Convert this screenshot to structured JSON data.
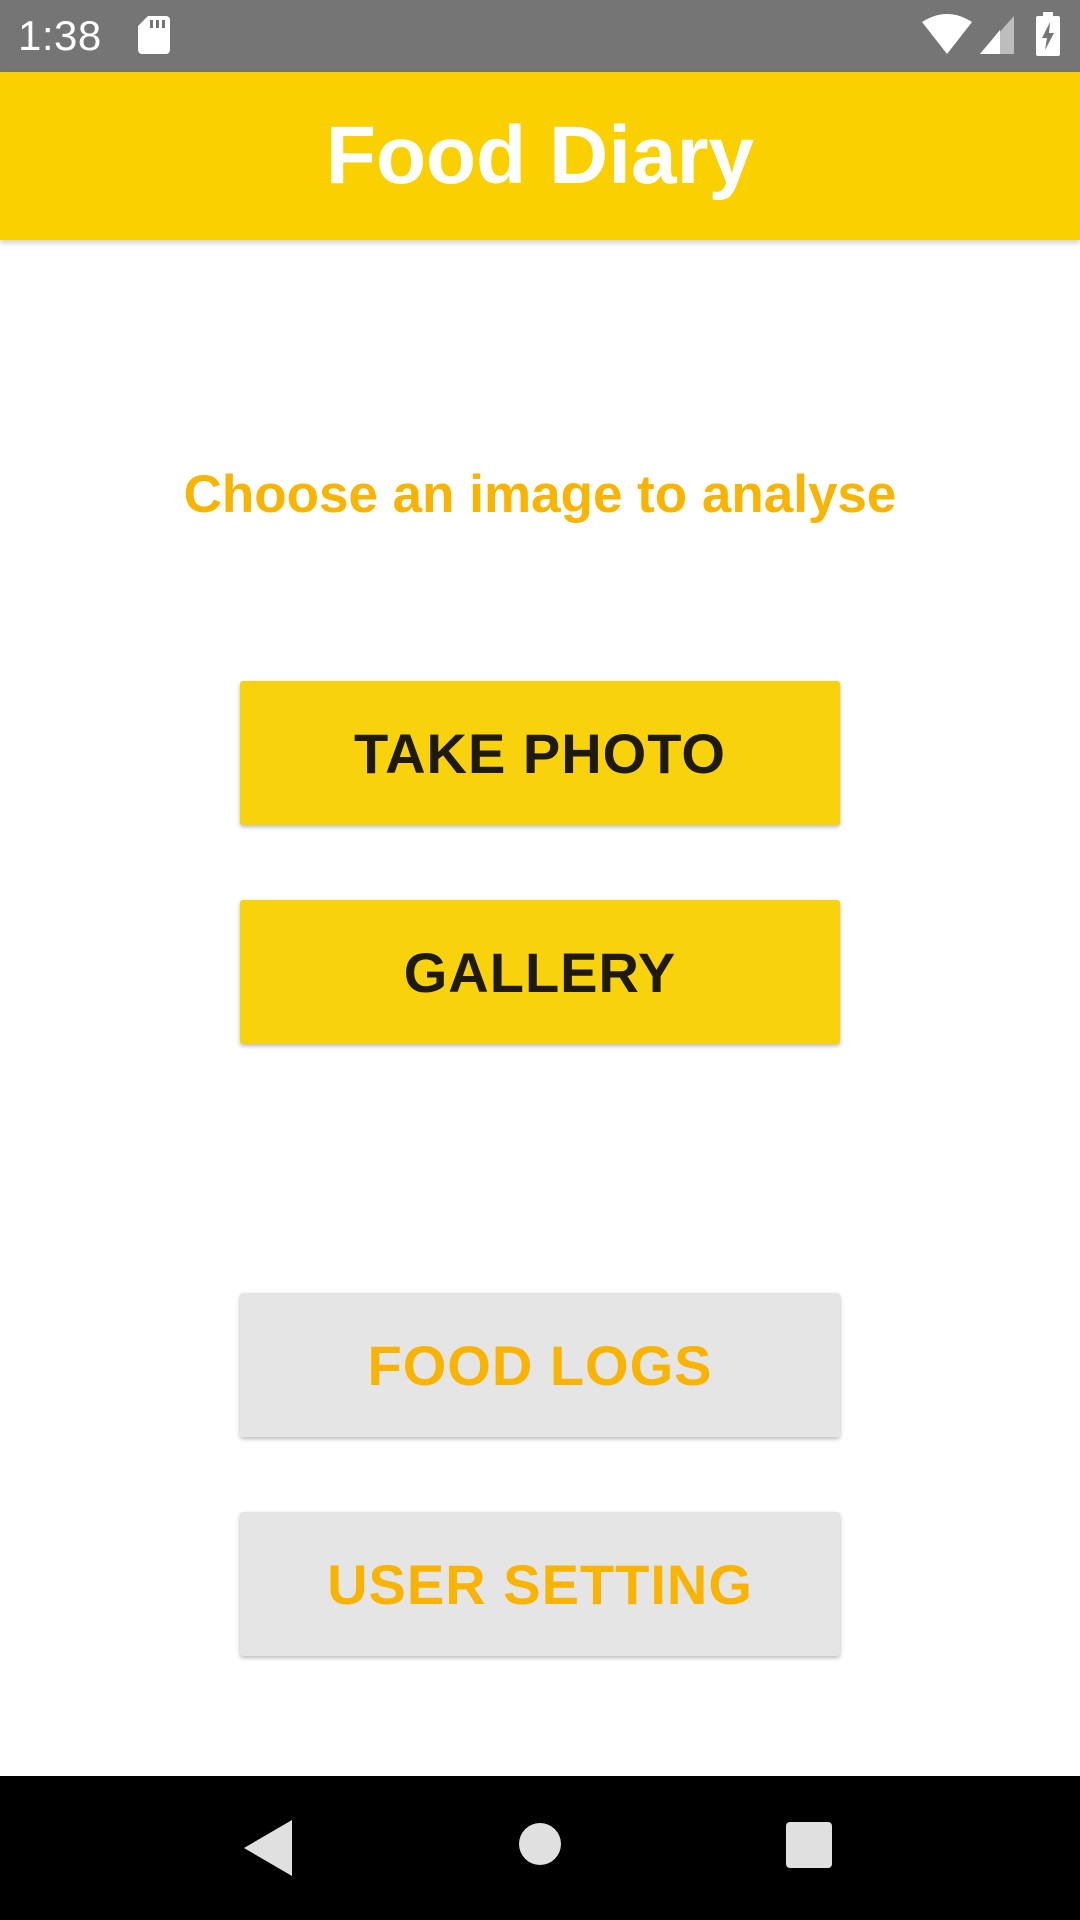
{
  "status_bar": {
    "time": "1:38",
    "icons": [
      "sd-card-icon",
      "wifi-icon",
      "cell-signal-icon",
      "battery-charging-icon"
    ]
  },
  "app_bar": {
    "title": "Food Diary"
  },
  "main": {
    "prompt": "Choose an image to analyse",
    "take_photo_label": "TAKE PHOTO",
    "gallery_label": "GALLERY",
    "food_logs_label": "FOOD LOGS",
    "user_setting_label": "USER SETTING"
  },
  "nav_bar": {
    "icons": [
      "back-icon",
      "home-icon",
      "recents-icon"
    ]
  },
  "colors": {
    "status_bar": "#757575",
    "app_bar": "#fbd000",
    "primary_button": "#f8d20c",
    "primary_button_text": "#1e1a10",
    "secondary_button": "#e5e5e5",
    "accent_text": "#f8b400",
    "nav_bar": "#000000"
  }
}
